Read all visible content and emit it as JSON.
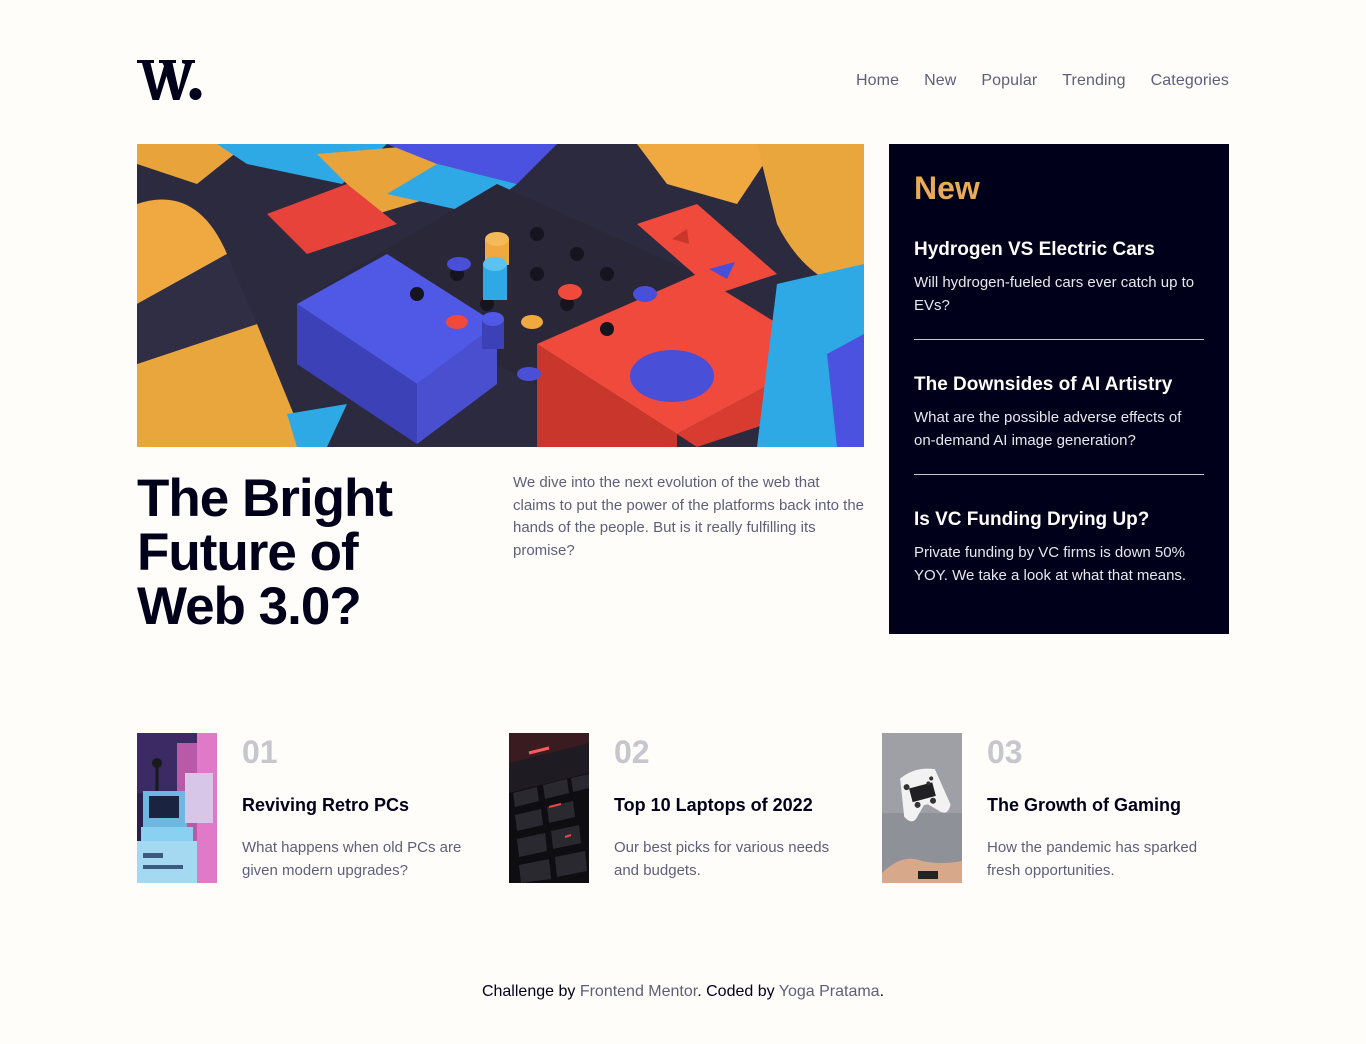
{
  "header": {
    "logo_alt": "W.",
    "nav": [
      "Home",
      "New",
      "Popular",
      "Trending",
      "Categories"
    ]
  },
  "hero": {
    "title_lines": [
      "The Bright",
      "Future of",
      "Web 3.0?"
    ],
    "description": "We dive into the next evolution of the web that claims to put the power of the platforms back into the hands of the people. But is it really fulfilling its promise?"
  },
  "new_section": {
    "heading": "New",
    "items": [
      {
        "title": "Hydrogen VS Electric Cars",
        "description": "Will hydrogen-fueled cars ever catch up to EVs?"
      },
      {
        "title": "The Downsides of AI Artistry",
        "description": "What are the possible adverse effects of on-demand AI image generation?"
      },
      {
        "title": "Is VC Funding Drying Up?",
        "description": "Private funding by VC firms is down 50% YOY. We take a look at what that means."
      }
    ]
  },
  "cards": [
    {
      "number": "01",
      "title": "Reviving Retro PCs",
      "description": "What happens when old PCs are given modern upgrades?"
    },
    {
      "number": "02",
      "title": "Top 10 Laptops of 2022",
      "description": "Our best picks for various needs and budgets."
    },
    {
      "number": "03",
      "title": "The Growth of Gaming",
      "description": "How the pandemic has sparked fresh opportunities."
    }
  ],
  "footer": {
    "prefix": "Challenge by",
    "challenge_link": "Frontend Mentor",
    "middle": ". Coded by",
    "author_link": "Yoga Pratama",
    "suffix": "."
  },
  "colors": {
    "background": "#fffdfa",
    "dark": "#00001a",
    "accent_orange": "#e9ab53",
    "muted_text": "#5d5f79",
    "number_gray": "#c5c6ce"
  }
}
